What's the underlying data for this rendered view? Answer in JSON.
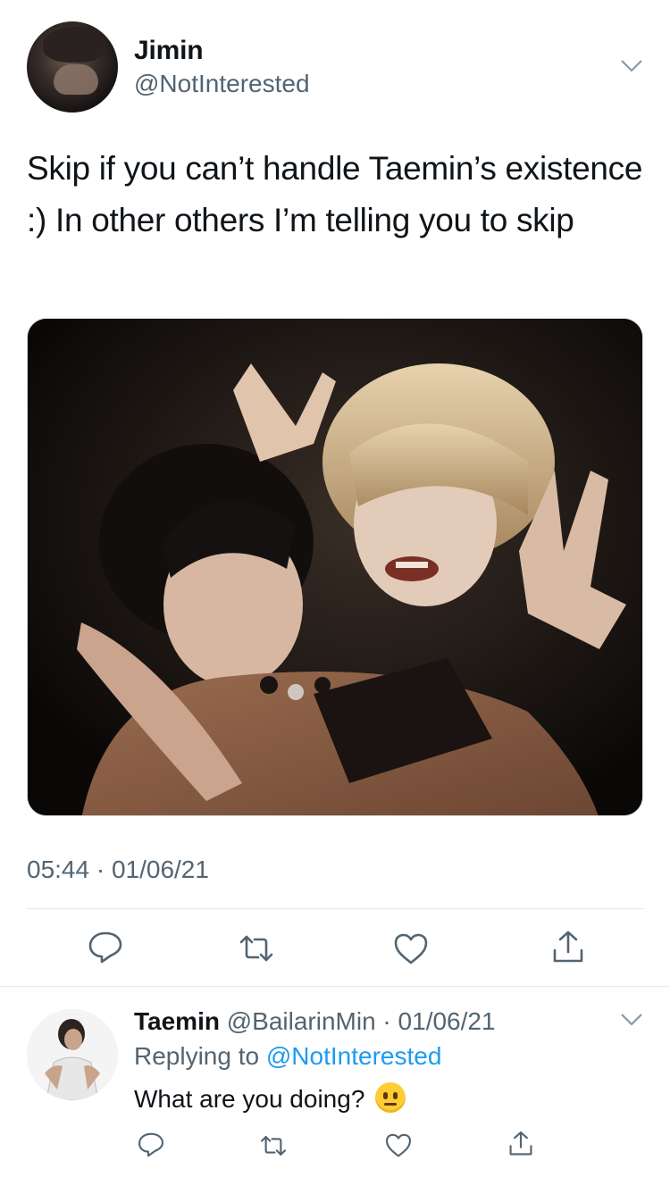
{
  "tweet": {
    "author_name": "Jimin",
    "author_handle": "@NotInterested",
    "text": "Skip if you can’t handle Taemin’s existence :) In other others I’m telling you to skip",
    "timestamp": "05:44 · 01/06/21"
  },
  "reply": {
    "author_name": "Taemin",
    "author_handle": "@BailarinMin",
    "separator": " · ",
    "date": "01/06/21",
    "replying_prefix": "Replying to ",
    "replying_to": "@NotInterested",
    "text": "What are you doing?"
  },
  "icons": {
    "reply": "comment-icon",
    "retweet": "retweet-icon",
    "like": "heart-icon",
    "share": "share-icon",
    "more": "chevron-down-icon",
    "emoji": "neutral-face-emoji"
  },
  "colors": {
    "text": "#0f1419",
    "secondary": "#536471",
    "link": "#1d9bf0",
    "divider": "#e6e9eb"
  }
}
